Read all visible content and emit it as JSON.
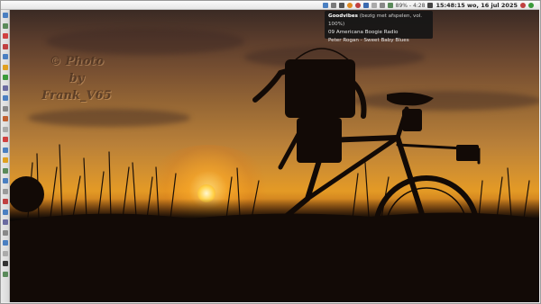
{
  "panel": {
    "battery_text": "89% - 4:28",
    "clock_text": "15:48:15 wo, 16 jul 2025",
    "tray_icons": [
      "network-icon",
      "display-icon",
      "volume-icon",
      "mail-icon",
      "chat-icon",
      "bluetooth-icon",
      "update-icon",
      "clipboard-icon",
      "battery-icon",
      "notification-bell-icon",
      "power-icon"
    ]
  },
  "notification": {
    "app": "Goodvibes",
    "status": "(bezig met afspelen, vol. 100%)",
    "station": "09 Americana Boogie Radio",
    "track": "Peter Rogan - Sweet Baby Blues"
  },
  "wallpaper": {
    "watermark_line1": "© Photo",
    "watermark_line2": "by",
    "watermark_line3": "Frank_V65"
  },
  "launcher": {
    "icon_colors": [
      "#4a7fc1",
      "#5a8a5a",
      "#d04040",
      "#c04040",
      "#4a7fc1",
      "#e0a020",
      "#3a9a3a",
      "#6a6aa0",
      "#4a7fc1",
      "#888888",
      "#c06030",
      "#aaaaaa",
      "#d04040",
      "#4a7fc1",
      "#e0a020",
      "#5a8a5a",
      "#4a7fc1",
      "#9a9a9a",
      "#c04040",
      "#4a7fc1",
      "#6a6aa0",
      "#888888",
      "#4a7fc1",
      "#aaaaaa",
      "#333333",
      "#5a8a5a"
    ]
  },
  "colors": {
    "panel_bg": "#f0f0f0",
    "notify_bg": "#161616",
    "sky_top": "#3a2a24",
    "sun": "#ffd24a"
  }
}
